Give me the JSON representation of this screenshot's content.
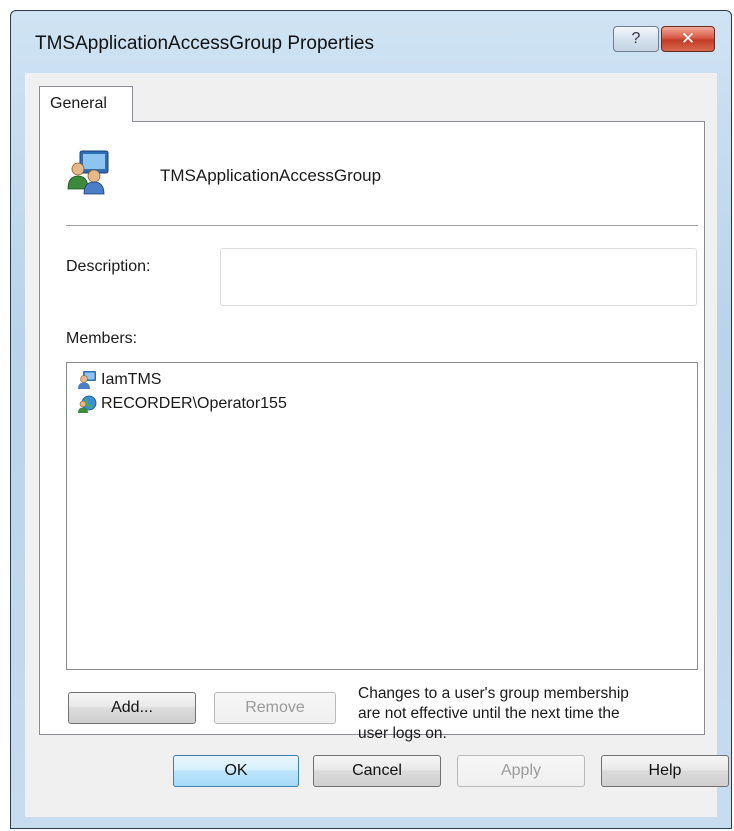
{
  "window": {
    "title": "TMSApplicationAccessGroup Properties",
    "help_glyph": "?",
    "close_glyph": "✕"
  },
  "tabs": [
    {
      "label": "General",
      "selected": true
    }
  ],
  "general": {
    "group_name": "TMSApplicationAccessGroup",
    "group_icon": "users-group-icon",
    "description_label": "Description:",
    "description_value": "",
    "members_label": "Members:",
    "members": [
      {
        "name": "IamTMS",
        "icon": "user-icon"
      },
      {
        "name": "RECORDER\\Operator155",
        "icon": "network-user-icon"
      }
    ],
    "add_label": "Add...",
    "remove_label": "Remove",
    "note_lines": [
      "Changes to a user's group membership",
      "are not effective until the next time the",
      "user logs on."
    ]
  },
  "footer": {
    "ok_label": "OK",
    "cancel_label": "Cancel",
    "apply_label": "Apply",
    "help_label": "Help"
  },
  "colors": {
    "titlebar": "#c5dbef",
    "close_button": "#c9432c",
    "default_button_border": "#3c7fb1"
  }
}
